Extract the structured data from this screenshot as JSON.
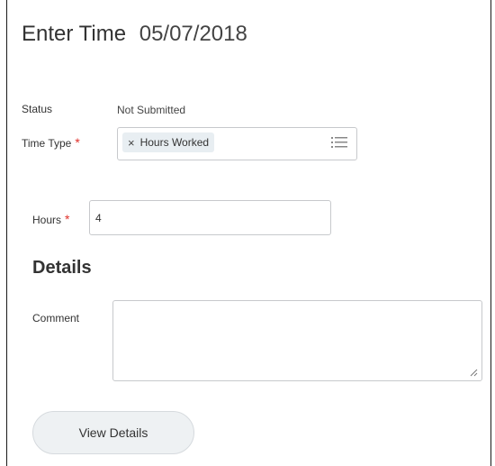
{
  "header": {
    "title": "Enter Time",
    "date": "05/07/2018"
  },
  "form": {
    "status": {
      "label": "Status",
      "value": "Not Submitted"
    },
    "time_type": {
      "label": "Time Type",
      "required_mark": "*",
      "selected": "Hours Worked",
      "remove_glyph": "×"
    },
    "hours": {
      "label": "Hours",
      "required_mark": "*",
      "value": "4"
    }
  },
  "details": {
    "heading": "Details",
    "comment": {
      "label": "Comment",
      "value": ""
    }
  },
  "actions": {
    "view_details_label": "View Details"
  },
  "colors": {
    "required": "#e0312b",
    "pill_bg": "#e8eef2",
    "button_bg": "#eef1f3"
  },
  "icons": {
    "list": "list-icon",
    "remove": "close-icon",
    "resize": "resize-handle-icon"
  }
}
